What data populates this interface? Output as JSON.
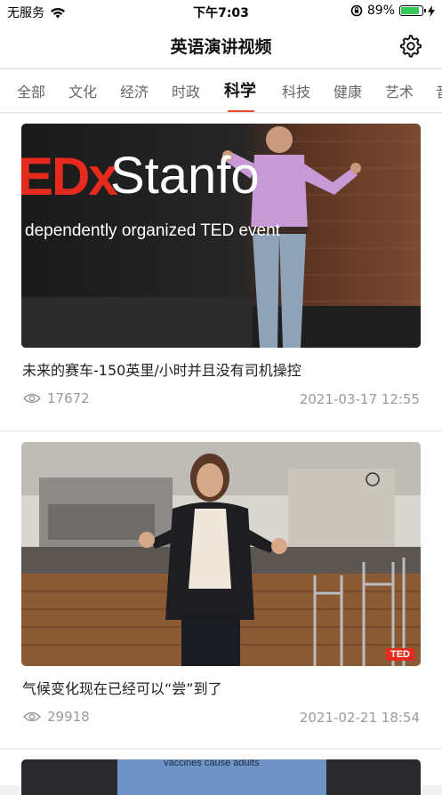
{
  "status_bar": {
    "carrier": "无服务",
    "time": "下午7:03",
    "battery": "89%",
    "battery_level": 0.89
  },
  "nav": {
    "title": "英语演讲视频",
    "settings_icon": "gear-icon"
  },
  "tabs": [
    {
      "label": "全部",
      "active": false
    },
    {
      "label": "文化",
      "active": false
    },
    {
      "label": "经济",
      "active": false
    },
    {
      "label": "时政",
      "active": false
    },
    {
      "label": "科学",
      "active": true
    },
    {
      "label": "科技",
      "active": false
    },
    {
      "label": "健康",
      "active": false
    },
    {
      "label": "艺术",
      "active": false
    },
    {
      "label": "音",
      "active": false
    }
  ],
  "feed": [
    {
      "title": "未来的赛车-150英里/小时并且没有司机操控",
      "views": "17672",
      "date": "2021-03-17 12:55",
      "thumb_text": {
        "brand_big": "EDx",
        "brand_name": "Stanfo",
        "brand_sub": "dependently organized TED event"
      }
    },
    {
      "title": "气候变化现在已经可以“尝”到了",
      "views": "29918",
      "date": "2021-02-21 18:54",
      "thumb_text": {
        "badge": "TED"
      }
    },
    {
      "title": "",
      "views": "",
      "date": "",
      "thumb_text": {
        "slide_text": "vaccines cause adults"
      }
    }
  ],
  "colors": {
    "accent": "#e64a2e",
    "ted_red": "#e62b1e",
    "battery_green": "#34c759"
  }
}
